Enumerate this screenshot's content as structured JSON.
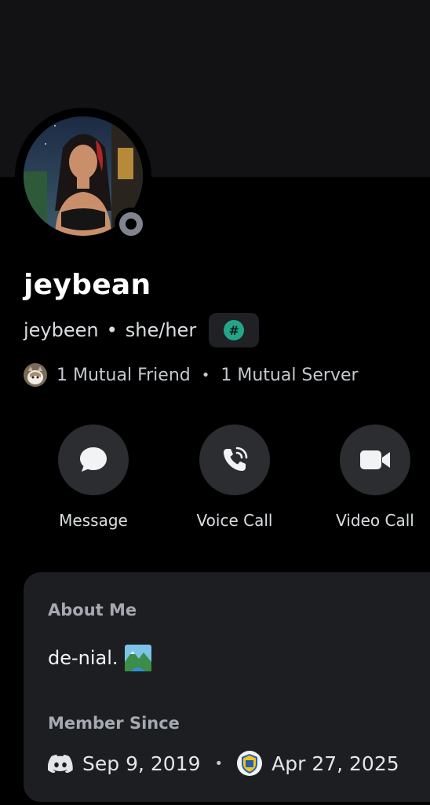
{
  "profile": {
    "display_name": "jeybean",
    "username": "jeybeen",
    "separator": "•",
    "pronouns": "she/her",
    "server_tag_symbol": "#",
    "status": "offline"
  },
  "mutuals": {
    "friends_label": "1 Mutual Friend",
    "separator": "•",
    "servers_label": "1 Mutual Server"
  },
  "actions": [
    {
      "label": "Message",
      "icon": "chat-bubble-icon"
    },
    {
      "label": "Voice Call",
      "icon": "phone-icon"
    },
    {
      "label": "Video Call",
      "icon": "video-camera-icon"
    }
  ],
  "about": {
    "title": "About Me",
    "text": "de-nial.",
    "emoji_icon": "landscape-emoji-icon"
  },
  "member_since": {
    "title": "Member Since",
    "discord_date": "Sep 9, 2019",
    "separator": "•",
    "server_date": "Apr 27, 2025"
  },
  "colors": {
    "background": "#000000",
    "banner": "#121214",
    "card": "#1d1e22",
    "action_button": "#2b2d31",
    "tag_accent": "#23a58a",
    "status_offline": "#80848e"
  }
}
